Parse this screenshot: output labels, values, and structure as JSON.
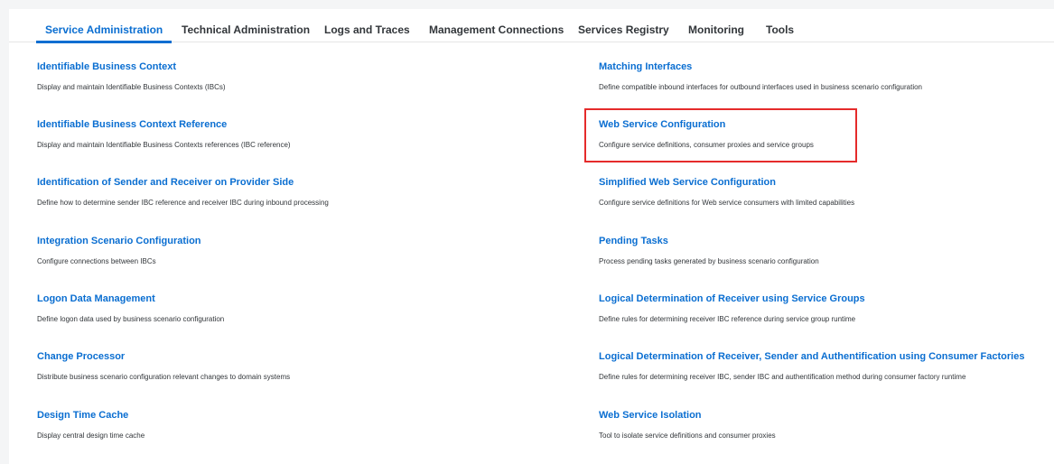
{
  "tabs": [
    {
      "label": "Service Administration",
      "selected": true
    },
    {
      "label": "Technical Administration",
      "selected": false
    },
    {
      "label": "Logs and Traces",
      "selected": false
    },
    {
      "label": "Management Connections",
      "selected": false
    },
    {
      "label": "Services Registry",
      "selected": false
    },
    {
      "label": "Monitoring",
      "selected": false
    },
    {
      "label": "Tools",
      "selected": false
    }
  ],
  "left_column": [
    {
      "title": "Identifiable Business Context",
      "description": "Display and maintain Identifiable Business Contexts (IBCs)"
    },
    {
      "title": "Identifiable Business Context Reference",
      "description": "Display and maintain Identifiable Business Contexts references (IBC reference)"
    },
    {
      "title": "Identification of Sender and Receiver on Provider Side",
      "description": "Define how to determine sender IBC reference and receiver IBC during inbound processing"
    },
    {
      "title": "Integration Scenario Configuration",
      "description": "Configure connections between IBCs"
    },
    {
      "title": "Logon Data Management",
      "description": "Define logon data used by business scenario configuration"
    },
    {
      "title": "Change Processor",
      "description": "Distribute business scenario configuration relevant changes to domain systems"
    },
    {
      "title": "Design Time Cache",
      "description": "Display central design time cache"
    }
  ],
  "right_column": [
    {
      "title": "Matching Interfaces",
      "description": "Define compatible inbound interfaces for outbound interfaces used in business scenario configuration"
    },
    {
      "title": "Web Service Configuration",
      "description": "Configure service definitions, consumer proxies and service groups",
      "highlighted": true
    },
    {
      "title": "Simplified Web Service Configuration",
      "description": "Configure service definitions for Web service consumers with limited capabilities"
    },
    {
      "title": "Pending Tasks",
      "description": "Process pending tasks generated by business scenario configuration"
    },
    {
      "title": "Logical Determination of Receiver using Service Groups",
      "description": "Define rules for determining receiver IBC reference during service group runtime"
    },
    {
      "title": "Logical Determination of Receiver, Sender and Authentification using Consumer Factories",
      "description": "Define rules for determining receiver IBC, sender IBC and authentification method during consumer factory runtime"
    },
    {
      "title": "Web Service Isolation",
      "description": "Tool to isolate service definitions and consumer proxies"
    }
  ],
  "colors": {
    "accent": "#0a6ed1",
    "highlight": "#e52b2b",
    "text": "#32363a"
  }
}
